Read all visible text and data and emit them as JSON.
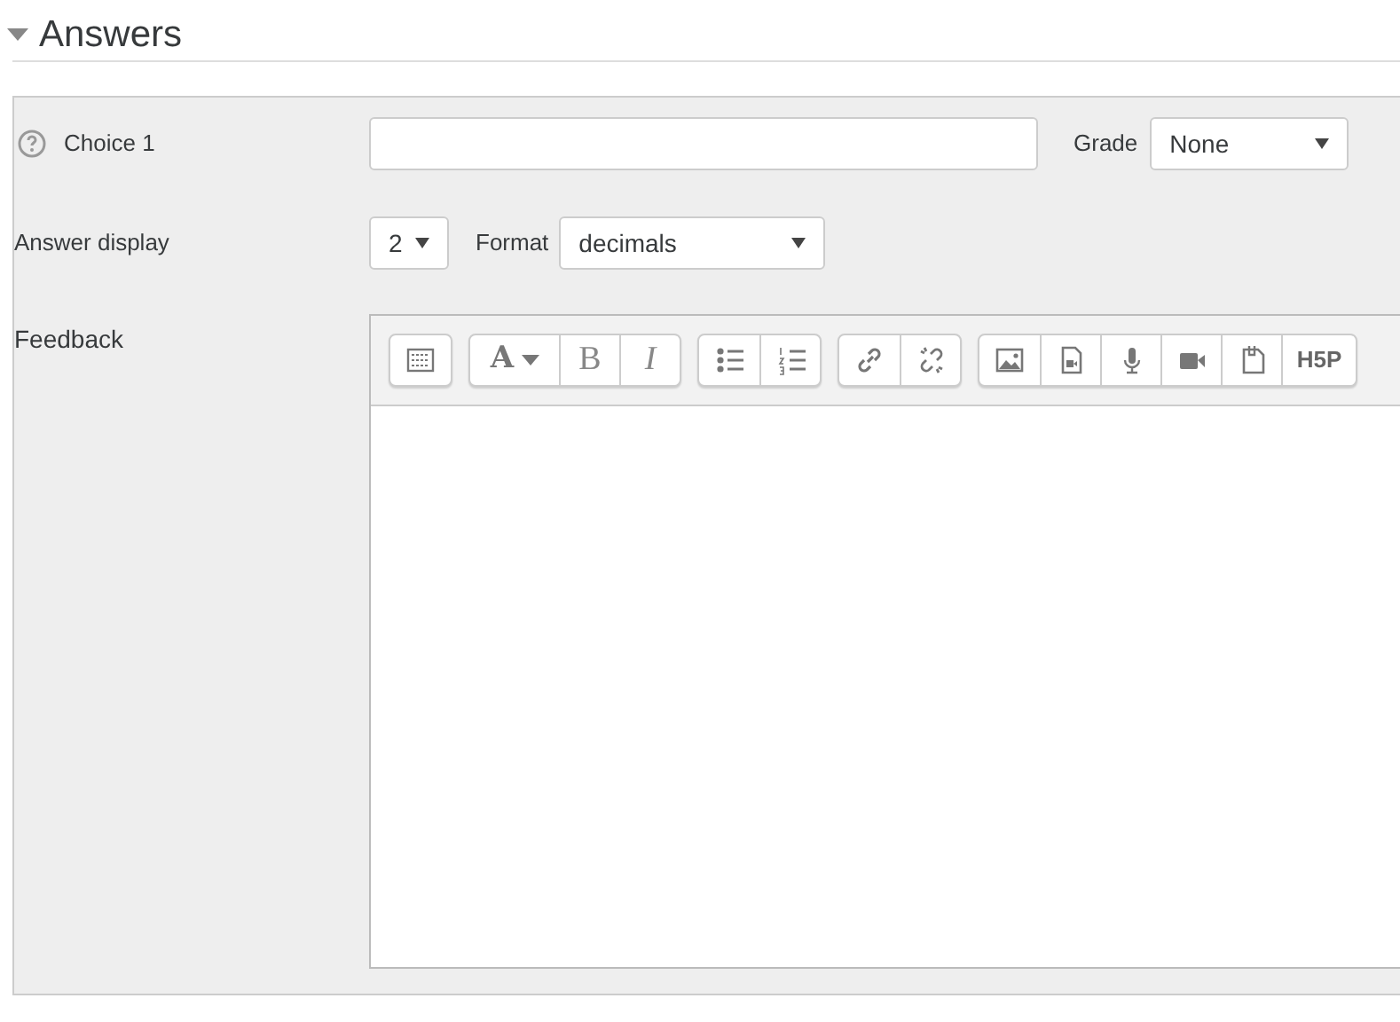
{
  "section": {
    "title": "Answers",
    "expanded": true
  },
  "choice": {
    "label": "Choice 1",
    "grade_label": "Grade",
    "grade_value": "None"
  },
  "answer_display": {
    "label": "Answer display",
    "value": "2",
    "format_label": "Format",
    "format_value": "decimals"
  },
  "feedback": {
    "label": "Feedback",
    "toolbar": [
      [
        {
          "kind": "toggle"
        }
      ],
      [
        {
          "kind": "font-color",
          "text": "A"
        },
        {
          "kind": "bold",
          "text": "B"
        },
        {
          "kind": "italic",
          "text": "I"
        }
      ],
      [
        {
          "kind": "bullets"
        },
        {
          "kind": "numbers"
        }
      ],
      [
        {
          "kind": "link"
        },
        {
          "kind": "unlink"
        }
      ],
      [
        {
          "kind": "image"
        },
        {
          "kind": "media"
        },
        {
          "kind": "mic"
        },
        {
          "kind": "video"
        },
        {
          "kind": "files"
        },
        {
          "kind": "h5p",
          "text": "H5P"
        }
      ]
    ]
  }
}
